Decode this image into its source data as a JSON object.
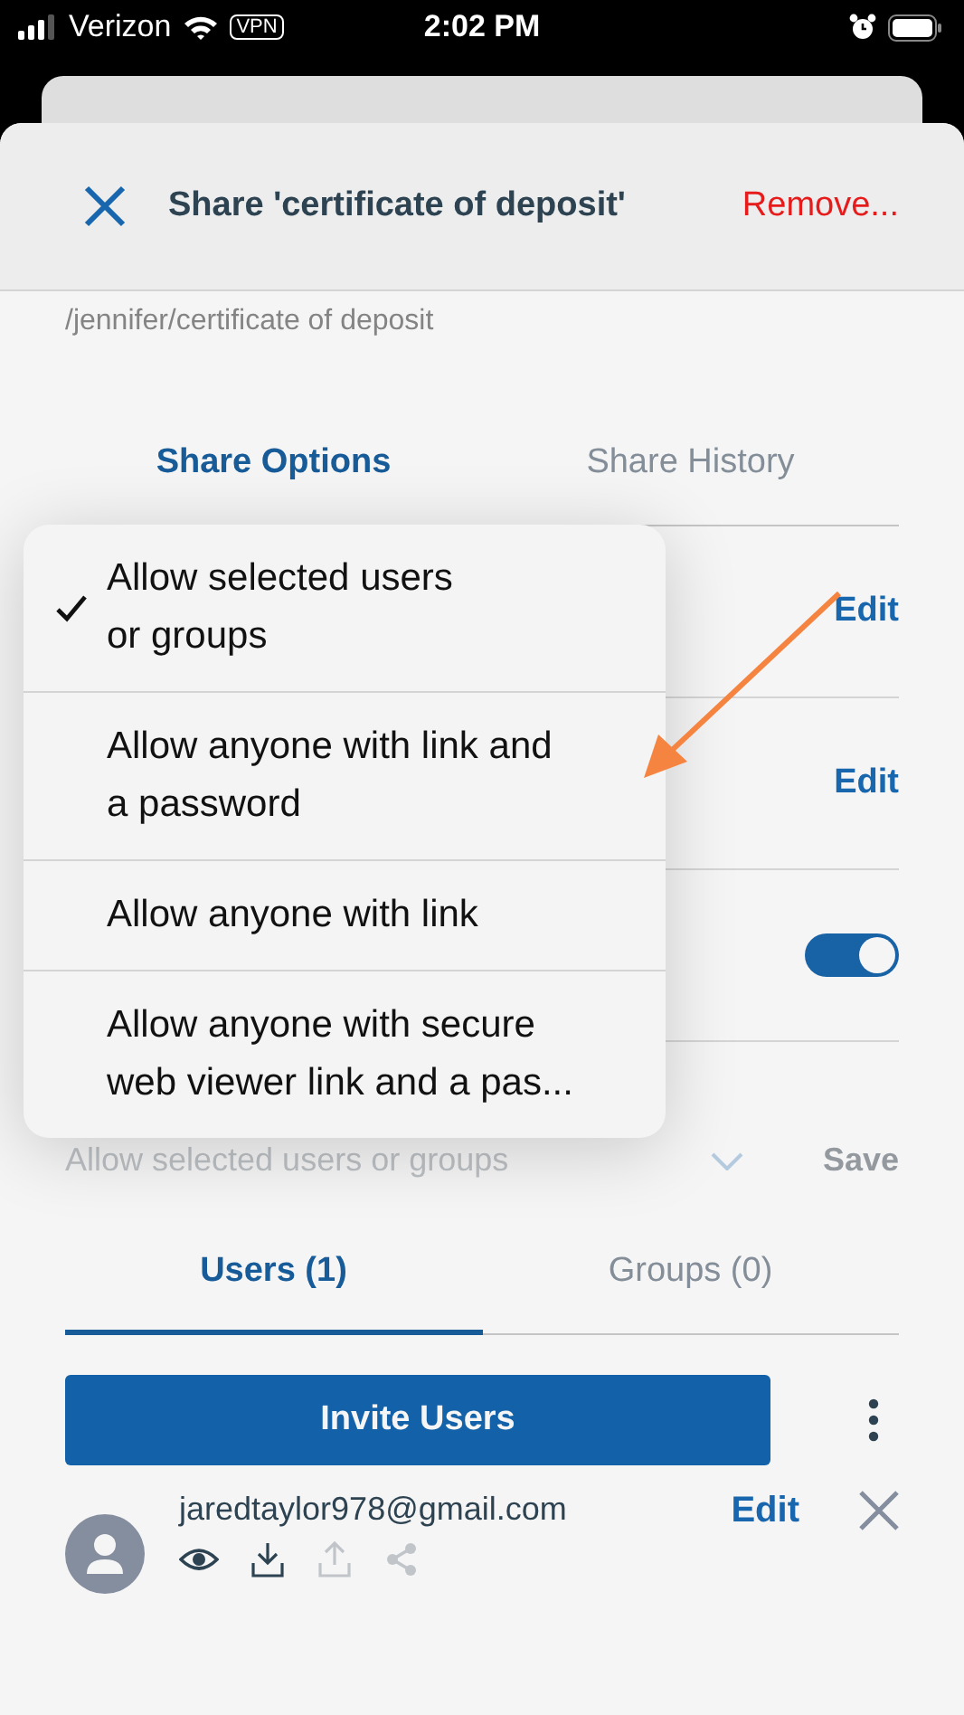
{
  "status_bar": {
    "carrier": "Verizon",
    "vpn": "VPN",
    "time": "2:02 PM"
  },
  "header": {
    "title": "Share 'certificate of deposit'",
    "action": "Remove..."
  },
  "path": "/jennifer/certificate of deposit",
  "tabs": [
    {
      "label": "Share Options",
      "selected": true
    },
    {
      "label": "Share History",
      "selected": false
    }
  ],
  "option_rows": [
    {
      "kind": "edit",
      "action": "Edit"
    },
    {
      "kind": "edit",
      "action": "Edit"
    },
    {
      "kind": "toggle",
      "on": true
    }
  ],
  "permissions_select": {
    "value": "Allow selected users or groups",
    "action": "Save"
  },
  "member_tabs": [
    {
      "label": "Users (1)",
      "selected": true
    },
    {
      "label": "Groups (0)",
      "selected": false
    }
  ],
  "invite_button": "Invite Users",
  "users": [
    {
      "email": "jaredtaylor978@gmail.com",
      "action": "Edit",
      "permissions": [
        {
          "kind": "view",
          "enabled": true
        },
        {
          "kind": "download",
          "enabled": true
        },
        {
          "kind": "upload",
          "enabled": false
        },
        {
          "kind": "share",
          "enabled": false
        }
      ]
    }
  ],
  "menu": [
    {
      "label": "Allow selected users\nor groups",
      "selected": true
    },
    {
      "label": "Allow anyone with link and\na password",
      "selected": false
    },
    {
      "label": "Allow anyone with link",
      "selected": false
    },
    {
      "label": "Allow anyone with secure\nweb viewer link and a pas...",
      "selected": false
    }
  ]
}
